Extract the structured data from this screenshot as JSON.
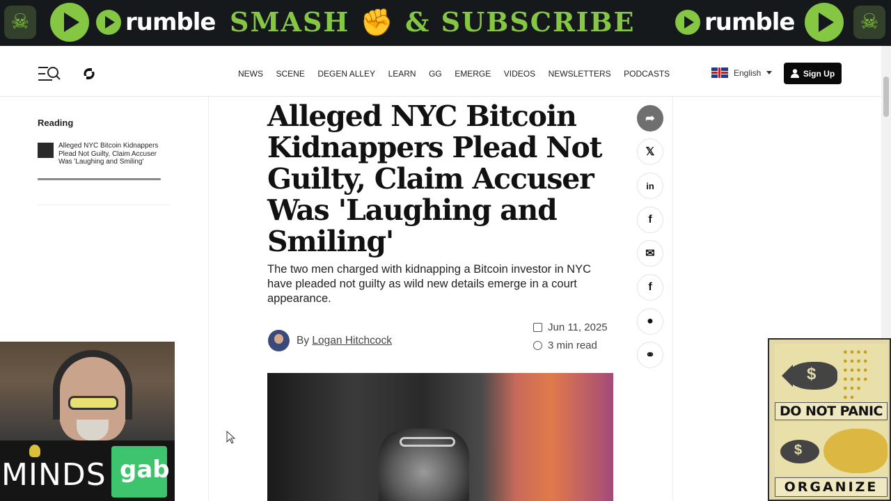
{
  "banner": {
    "logo_text": "rumble",
    "slogan": "SMASH ✊ & SUBSCRIBE",
    "accent": "#85c742"
  },
  "nav": {
    "ghost_breadcrumb": "",
    "menu_icon": "menu-search-icon",
    "links": [
      "NEWS",
      "SCENE",
      "DEGEN ALLEY",
      "LEARN",
      "GG",
      "EMERGE",
      "VIDEOS",
      "NEWSLETTERS",
      "PODCASTS"
    ],
    "language": "English",
    "signup_label": "Sign Up"
  },
  "reading": {
    "title": "Reading",
    "item": "Alleged NYC Bitcoin Kidnappers Plead Not Guilty, Claim Accuser Was 'Laughing and Smiling'",
    "progress": 1.0
  },
  "article": {
    "headline": "Alleged NYC Bitcoin Kidnappers Plead Not Guilty, Claim Accuser Was 'Laughing and Smiling'",
    "subhead": "The two men charged with kidnapping a Bitcoin investor in NYC have pleaded not guilty as wild new details emerge in a court appearance.",
    "by": "By",
    "author": "Logan Hitchcock",
    "date": "Jun 11, 2025",
    "read_time": "3 min read"
  },
  "share": {
    "icons": [
      "share-icon",
      "x-icon",
      "linkedin-icon",
      "flipboard-icon",
      "email-icon",
      "facebook-icon",
      "reddit-icon",
      "link-icon"
    ],
    "glyphs": [
      "➦",
      "𝕏",
      "in",
      "f",
      "✉",
      "f",
      "●",
      "⚭"
    ]
  },
  "overlays": {
    "minds_text": "MINDS",
    "gab_text": "gab",
    "poster_top": "DO NOT PANIC",
    "poster_bottom": "ORGANIZE",
    "dollar": "$"
  }
}
